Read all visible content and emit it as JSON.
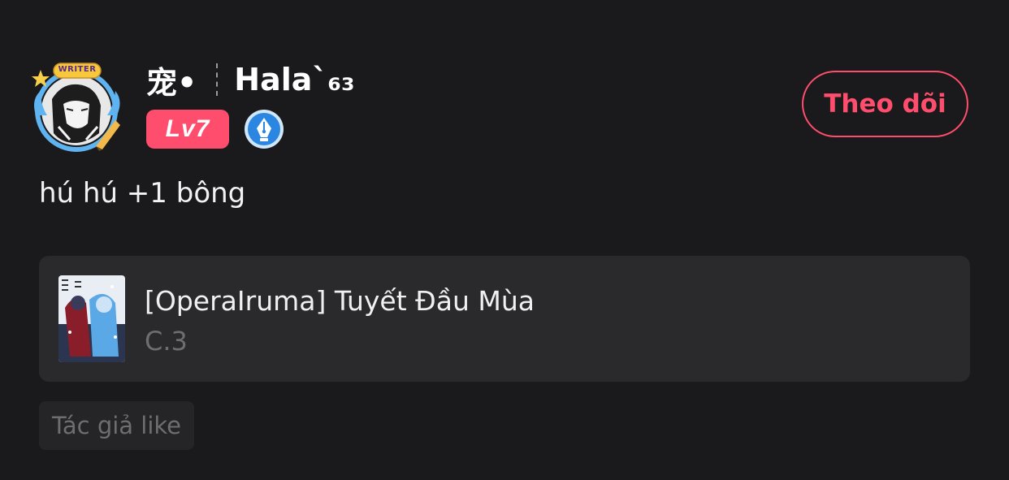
{
  "user": {
    "name_part1": "宠•",
    "name_part2": "Hala`₆₃",
    "level": "Lv7",
    "frame_label": "WRITER",
    "badge_icon": "pen-nib-icon",
    "follow_label": "Theo dõi"
  },
  "comment": {
    "text": "hú hú +1 bông"
  },
  "story": {
    "title": "[OperaIruma] Tuyết Đầu Mùa",
    "chapter": "C.3"
  },
  "tags": {
    "author_like": "Tác giả like"
  },
  "colors": {
    "background": "#1a191b",
    "accent": "#ff4d6d",
    "card": "#2a2a2c",
    "badge_blue": "#2a86e0"
  }
}
